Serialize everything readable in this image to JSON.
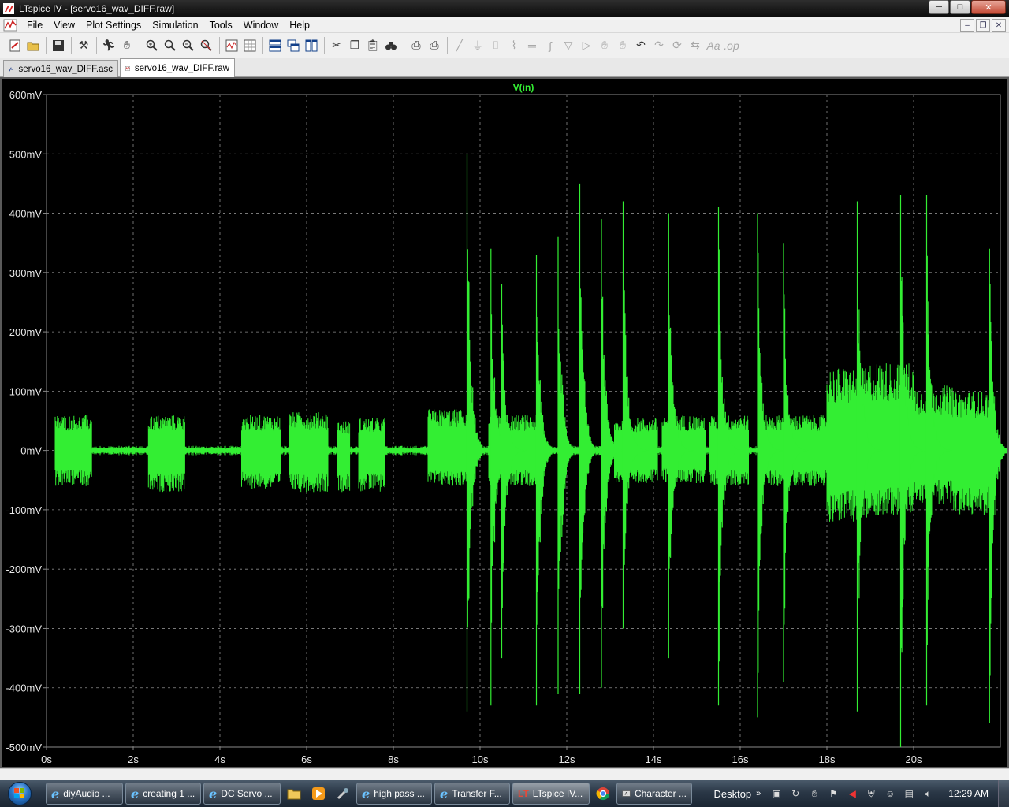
{
  "window": {
    "title": "LTspice IV - [servo16_wav_DIFF.raw]",
    "controls": {
      "minimize": "─",
      "maximize": "□",
      "close": "✕"
    }
  },
  "menu": {
    "items": [
      "File",
      "View",
      "Plot Settings",
      "Simulation",
      "Tools",
      "Window",
      "Help"
    ]
  },
  "toolbar": {
    "icons": [
      "new-schematic-icon",
      "open-icon",
      "save-icon",
      "control-panel-icon",
      "run-icon",
      "pan-icon",
      "zoom-in-icon",
      "zoom-area-icon",
      "zoom-out-icon",
      "zoom-fit-icon",
      "autorange-icon",
      "grid-icon",
      "tile-horizontal-icon",
      "cascade-icon",
      "tile-vertical-icon",
      "cut-icon",
      "copy-icon",
      "paste-icon",
      "find-icon",
      "print-setup-icon",
      "print-icon",
      "wire-icon",
      "ground-icon",
      "label-icon",
      "resistor-icon",
      "capacitor-icon",
      "inductor-icon",
      "diode-icon",
      "component-icon",
      "move-icon",
      "drag-icon",
      "undo-icon",
      "redo-icon",
      "rotate-icon",
      "mirror-icon",
      "text-icon",
      "spice-directive-icon"
    ]
  },
  "tabs": [
    {
      "label": "servo16_wav_DIFF.asc",
      "active": false
    },
    {
      "label": "servo16_wav_DIFF.raw",
      "active": true
    }
  ],
  "colors": {
    "trace": "#33ee33",
    "plot_bg": "#000000",
    "grid": "#8a8a8a",
    "axis_text": "#e8e8e8"
  },
  "chart_data": {
    "type": "line",
    "title": "V(in)",
    "xlabel": "",
    "ylabel": "",
    "xlim": [
      0,
      22
    ],
    "ylim": [
      -500,
      600
    ],
    "x_ticks": [
      "0s",
      "2s",
      "4s",
      "6s",
      "8s",
      "10s",
      "12s",
      "14s",
      "16s",
      "18s",
      "20s"
    ],
    "y_ticks": [
      "600mV",
      "500mV",
      "400mV",
      "300mV",
      "200mV",
      "100mV",
      "0mV",
      "-100mV",
      "-200mV",
      "-300mV",
      "-400mV",
      "-500mV"
    ],
    "grid": true,
    "series": [
      {
        "name": "V(in)",
        "envelope_segments": [
          {
            "x_start": 0.2,
            "x_end": 1.05,
            "max": 60,
            "min": -60
          },
          {
            "x_start": 1.05,
            "x_end": 2.35,
            "max": 5,
            "min": -5
          },
          {
            "x_start": 2.35,
            "x_end": 3.2,
            "max": 60,
            "min": -70
          },
          {
            "x_start": 3.2,
            "x_end": 4.5,
            "max": 4,
            "min": -4
          },
          {
            "x_start": 4.5,
            "x_end": 5.4,
            "max": 60,
            "min": -65
          },
          {
            "x_start": 5.6,
            "x_end": 6.5,
            "max": 65,
            "min": -70
          },
          {
            "x_start": 6.7,
            "x_end": 7.0,
            "max": 50,
            "min": -70
          },
          {
            "x_start": 7.2,
            "x_end": 7.8,
            "max": 55,
            "min": -70
          },
          {
            "x_start": 7.8,
            "x_end": 8.8,
            "max": 4,
            "min": -4
          },
          {
            "x_start": 8.8,
            "x_end": 9.7,
            "max": 70,
            "min": -60
          },
          {
            "x_start": 10.2,
            "x_end": 11.4,
            "max": 60,
            "min": -60
          },
          {
            "x_start": 13.1,
            "x_end": 14.1,
            "max": 55,
            "min": -55
          },
          {
            "x_start": 14.2,
            "x_end": 15.2,
            "max": 60,
            "min": -55
          },
          {
            "x_start": 15.3,
            "x_end": 16.2,
            "max": 60,
            "min": -60
          },
          {
            "x_start": 16.6,
            "x_end": 18.0,
            "max": 60,
            "min": -60
          },
          {
            "x_start": 18.0,
            "x_end": 19.0,
            "max": 140,
            "min": -120
          },
          {
            "x_start": 19.0,
            "x_end": 20.0,
            "max": 150,
            "min": -110
          },
          {
            "x_start": 20.0,
            "x_end": 20.9,
            "max": 110,
            "min": -90
          },
          {
            "x_start": 20.9,
            "x_end": 21.9,
            "max": 100,
            "min": -110
          }
        ],
        "spikes": [
          {
            "x": 9.7,
            "max": 500,
            "min": -440
          },
          {
            "x": 10.25,
            "max": 340,
            "min": -430
          },
          {
            "x": 10.5,
            "max": 280,
            "min": -350
          },
          {
            "x": 11.3,
            "max": 330,
            "min": -430
          },
          {
            "x": 11.8,
            "max": 360,
            "min": -410
          },
          {
            "x": 12.3,
            "max": 450,
            "min": -410
          },
          {
            "x": 12.8,
            "max": 390,
            "min": -400
          },
          {
            "x": 13.3,
            "max": 420,
            "min": -300
          },
          {
            "x": 14.35,
            "max": 400,
            "min": -350
          },
          {
            "x": 15.5,
            "max": 410,
            "min": -430
          },
          {
            "x": 16.4,
            "max": 400,
            "min": -450
          },
          {
            "x": 17.0,
            "max": 350,
            "min": -390
          },
          {
            "x": 18.7,
            "max": 420,
            "min": -440
          },
          {
            "x": 19.7,
            "max": 430,
            "min": -500
          },
          {
            "x": 20.3,
            "max": 430,
            "min": -430
          },
          {
            "x": 21.75,
            "max": 340,
            "min": -460
          }
        ]
      }
    ]
  },
  "taskbar": {
    "buttons": [
      {
        "label": "diyAudio ...",
        "icon": "ie-icon",
        "active": false
      },
      {
        "label": "creating 1 ...",
        "icon": "ie-icon",
        "active": false
      },
      {
        "label": "DC Servo ...",
        "icon": "ie-icon",
        "active": false
      },
      {
        "label": "high pass ...",
        "icon": "ie-icon",
        "active": false
      },
      {
        "label": "Transfer F...",
        "icon": "ie-icon",
        "active": false
      },
      {
        "label": "LTspice IV...",
        "icon": "ltspice-icon",
        "active": true
      },
      {
        "label": "Character ...",
        "icon": "character-map-icon",
        "active": false
      }
    ],
    "quick_launch": [
      "explorer-icon",
      "media-player-icon",
      "tool-icon",
      "chrome-icon"
    ],
    "tray": {
      "desktop_label": "Desktop",
      "expand": "»",
      "clock": "12:29 AM"
    }
  }
}
